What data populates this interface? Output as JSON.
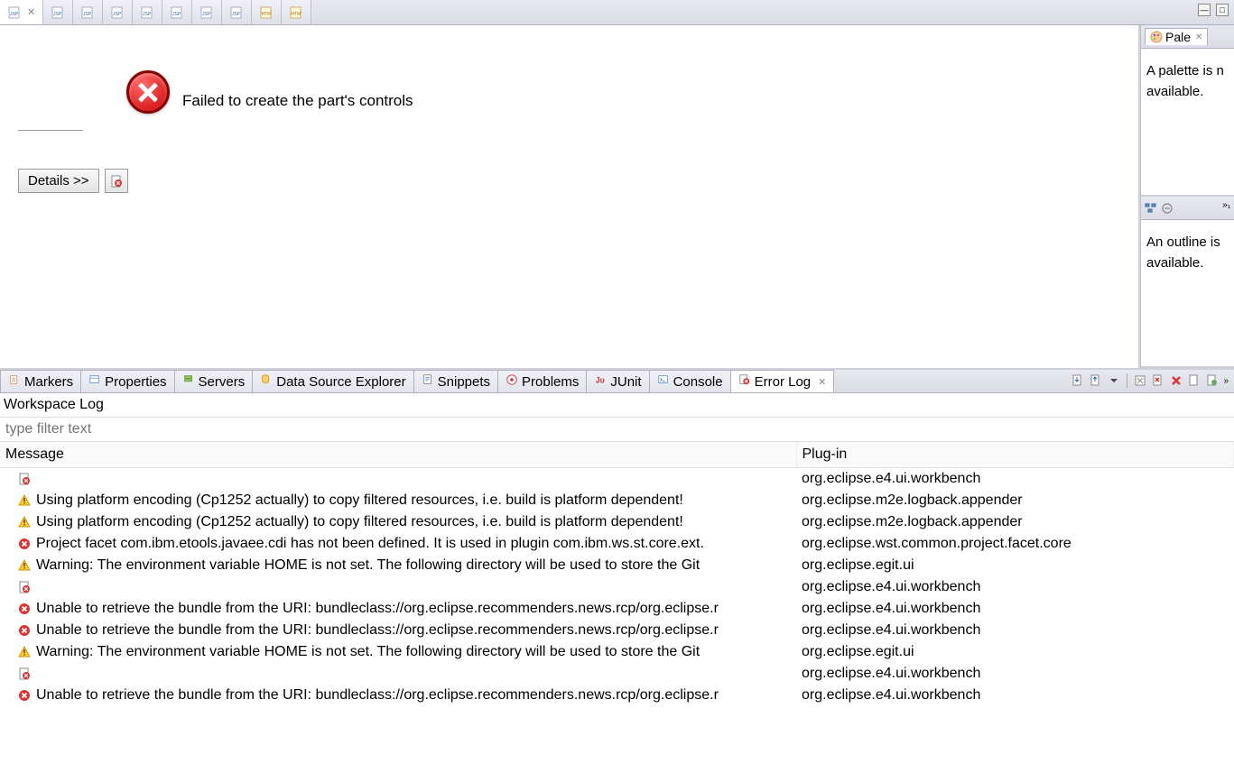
{
  "editorTabs": [
    {
      "type": "jsp",
      "active": true
    },
    {
      "type": "jsp"
    },
    {
      "type": "jsp"
    },
    {
      "type": "jsp"
    },
    {
      "type": "jsp"
    },
    {
      "type": "jsp"
    },
    {
      "type": "jsp"
    },
    {
      "type": "jsp"
    },
    {
      "type": "htm"
    },
    {
      "type": "htm"
    }
  ],
  "editorError": {
    "message": "Failed to create the part's controls",
    "detailsLabel": "Details >>"
  },
  "palette": {
    "tabLabel": "Pale",
    "content": "A palette is n available."
  },
  "outline": {
    "content": "An outline is available."
  },
  "bottomTabs": [
    {
      "label": "Markers",
      "icon": "markers"
    },
    {
      "label": "Properties",
      "icon": "properties"
    },
    {
      "label": "Servers",
      "icon": "servers"
    },
    {
      "label": "Data Source Explorer",
      "icon": "datasource"
    },
    {
      "label": "Snippets",
      "icon": "snippets"
    },
    {
      "label": "Problems",
      "icon": "problems"
    },
    {
      "label": "JUnit",
      "icon": "junit"
    },
    {
      "label": "Console",
      "icon": "console"
    },
    {
      "label": "Error Log",
      "icon": "errorlog",
      "active": true
    }
  ],
  "errorLog": {
    "title": "Workspace Log",
    "filterPlaceholder": "type filter text",
    "columns": {
      "message": "Message",
      "plugin": "Plug-in"
    },
    "rows": [
      {
        "icon": "errdoc",
        "message": "",
        "plugin": "org.eclipse.e4.ui.workbench"
      },
      {
        "icon": "warn",
        "message": "Using platform encoding (Cp1252 actually) to copy filtered resources, i.e. build is platform dependent!",
        "plugin": "org.eclipse.m2e.logback.appender"
      },
      {
        "icon": "warn",
        "message": "Using platform encoding (Cp1252 actually) to copy filtered resources, i.e. build is platform dependent!",
        "plugin": "org.eclipse.m2e.logback.appender"
      },
      {
        "icon": "err",
        "message": "Project facet com.ibm.etools.javaee.cdi has not been defined. It is used in plugin com.ibm.ws.st.core.ext.",
        "plugin": "org.eclipse.wst.common.project.facet.core"
      },
      {
        "icon": "warn",
        "message": "Warning: The environment variable HOME is not set. The following directory will be used to store the Git",
        "plugin": "org.eclipse.egit.ui"
      },
      {
        "icon": "errdoc",
        "message": "",
        "plugin": "org.eclipse.e4.ui.workbench"
      },
      {
        "icon": "err",
        "message": "Unable to retrieve the bundle from the URI: bundleclass://org.eclipse.recommenders.news.rcp/org.eclipse.r",
        "plugin": "org.eclipse.e4.ui.workbench"
      },
      {
        "icon": "err",
        "message": "Unable to retrieve the bundle from the URI: bundleclass://org.eclipse.recommenders.news.rcp/org.eclipse.r",
        "plugin": "org.eclipse.e4.ui.workbench"
      },
      {
        "icon": "warn",
        "message": "Warning: The environment variable HOME is not set. The following directory will be used to store the Git",
        "plugin": "org.eclipse.egit.ui"
      },
      {
        "icon": "errdoc",
        "message": "",
        "plugin": "org.eclipse.e4.ui.workbench"
      },
      {
        "icon": "err",
        "message": "Unable to retrieve the bundle from the URI: bundleclass://org.eclipse.recommenders.news.rcp/org.eclipse.r",
        "plugin": "org.eclipse.e4.ui.workbench"
      }
    ]
  }
}
